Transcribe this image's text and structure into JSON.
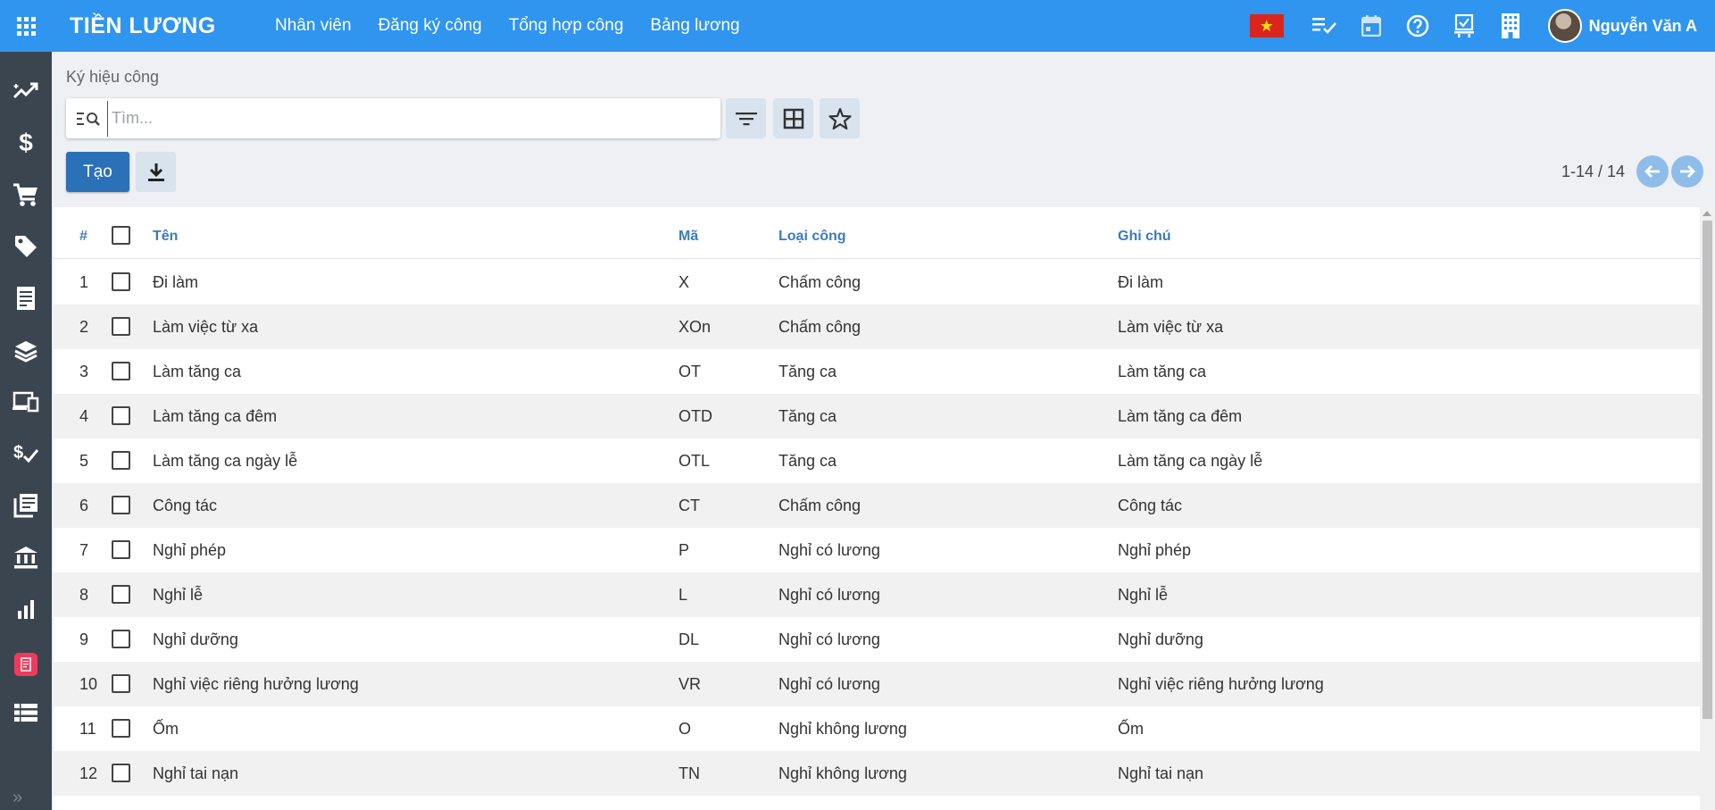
{
  "app": {
    "title": "TIỀN LƯƠNG"
  },
  "topnav": [
    "Nhân viên",
    "Đăng ký công",
    "Tổng hợp công",
    "Bảng lương"
  ],
  "user": {
    "name": "Nguyễn Văn A"
  },
  "breadcrumb": "Ký hiệu công",
  "search": {
    "placeholder": "Tìm..."
  },
  "actions": {
    "create": "Tạo"
  },
  "pager": {
    "text": "1-14 / 14"
  },
  "colors": {
    "primary": "#2f95ef",
    "sidebar": "#3b4550",
    "create": "#2b71b8",
    "header_text": "#3a7bbf"
  },
  "sidebar_icons": [
    "trending-up-icon",
    "dollar-icon",
    "cart-icon",
    "tag-icon",
    "receipt-icon",
    "stack-icon",
    "devices-icon",
    "payment-check-icon",
    "library-books-icon",
    "bank-icon",
    "bar-chart-icon",
    "note-app-icon",
    "list-icon"
  ],
  "table": {
    "columns": {
      "index": "#",
      "name": "Tên",
      "code": "Mã",
      "type": "Loại công",
      "note": "Ghi chú"
    },
    "rows": [
      {
        "no": "1",
        "name": "Đi làm",
        "code": "X",
        "type": "Chấm công",
        "note": "Đi làm"
      },
      {
        "no": "2",
        "name": "Làm việc từ xa",
        "code": "XOn",
        "type": "Chấm công",
        "note": "Làm việc từ xa"
      },
      {
        "no": "3",
        "name": "Làm tăng ca",
        "code": "OT",
        "type": "Tăng ca",
        "note": "Làm tăng ca"
      },
      {
        "no": "4",
        "name": "Làm tăng ca đêm",
        "code": "OTD",
        "type": "Tăng ca",
        "note": "Làm tăng ca đêm"
      },
      {
        "no": "5",
        "name": "Làm tăng ca ngày lễ",
        "code": "OTL",
        "type": "Tăng ca",
        "note": "Làm tăng ca ngày lễ"
      },
      {
        "no": "6",
        "name": "Công tác",
        "code": "CT",
        "type": "Chấm công",
        "note": "Công tác"
      },
      {
        "no": "7",
        "name": "Nghỉ phép",
        "code": "P",
        "type": "Nghỉ có lương",
        "note": "Nghỉ phép"
      },
      {
        "no": "8",
        "name": "Nghỉ lễ",
        "code": "L",
        "type": "Nghỉ có lương",
        "note": "Nghỉ lễ"
      },
      {
        "no": "9",
        "name": "Nghỉ dưỡng",
        "code": "DL",
        "type": "Nghỉ có lương",
        "note": "Nghỉ dưỡng"
      },
      {
        "no": "10",
        "name": "Nghỉ việc riêng hưởng lương",
        "code": "VR",
        "type": "Nghỉ có lương",
        "note": "Nghỉ việc riêng hưởng lương"
      },
      {
        "no": "11",
        "name": "Ốm",
        "code": "O",
        "type": "Nghỉ không lương",
        "note": "Ốm"
      },
      {
        "no": "12",
        "name": "Nghỉ tai nạn",
        "code": "TN",
        "type": "Nghỉ không lương",
        "note": "Nghỉ tai nạn"
      }
    ]
  }
}
